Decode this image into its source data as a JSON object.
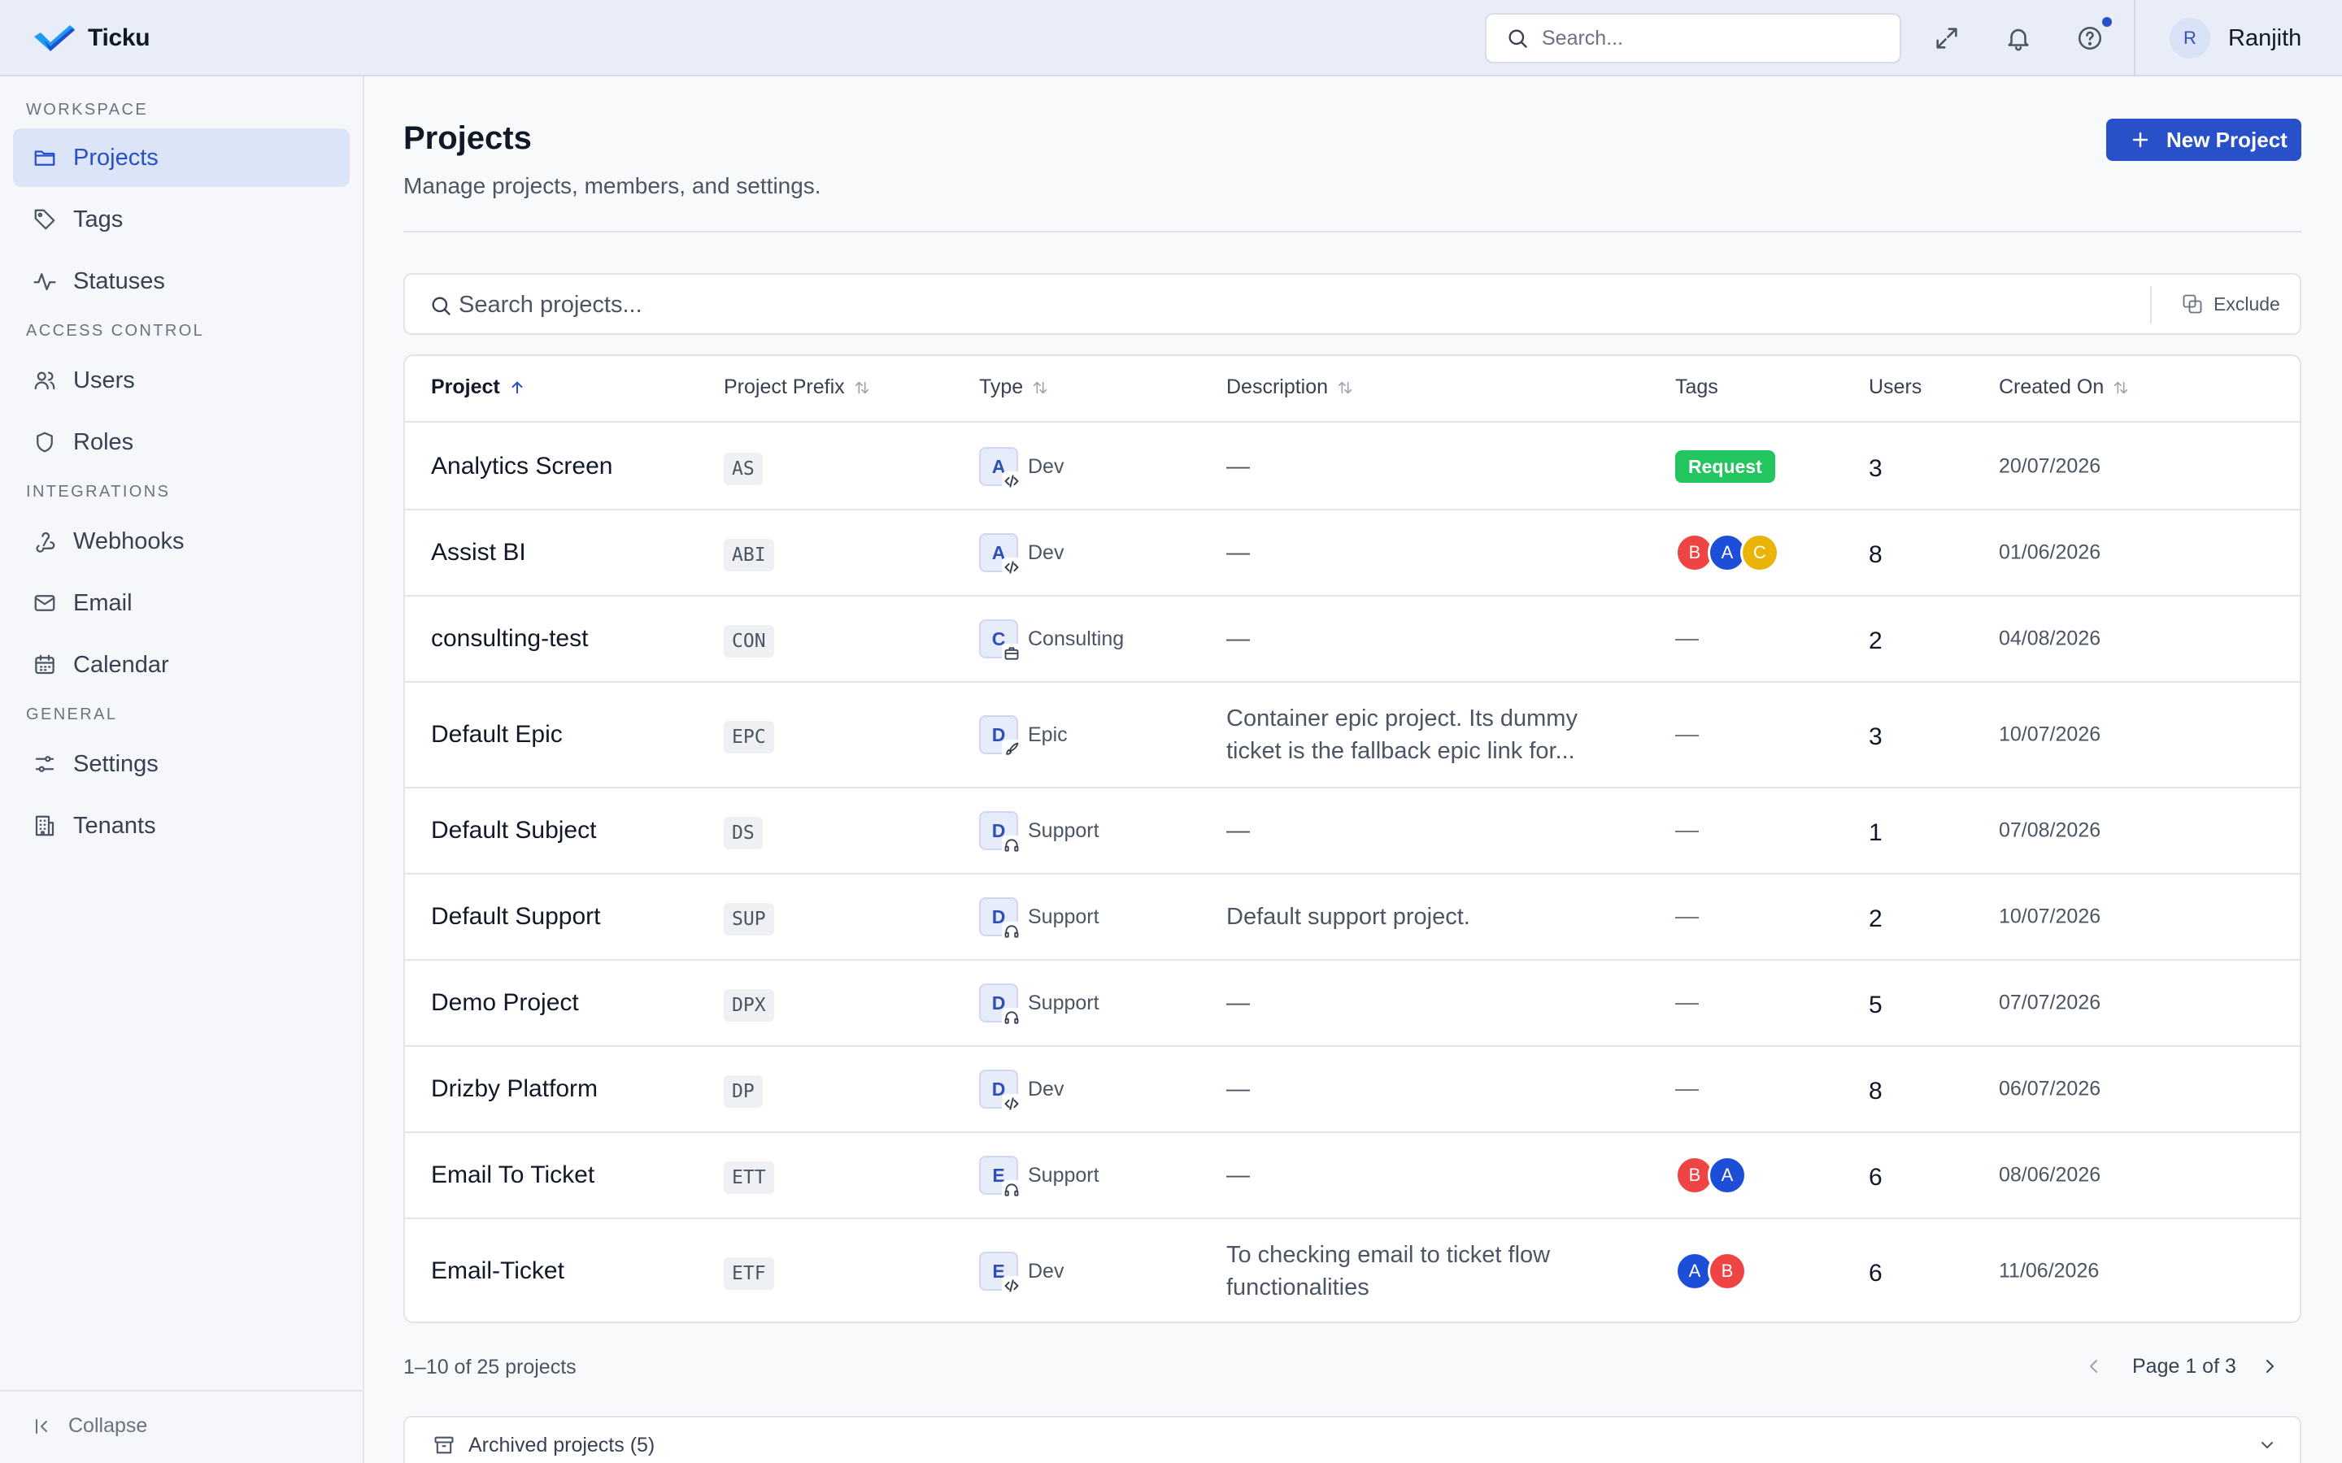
{
  "app": {
    "name": "Ticku"
  },
  "topbar": {
    "search_placeholder": "Search...",
    "user": {
      "initial": "R",
      "name": "Ranjith"
    },
    "notification_dot_color": "#2850c8"
  },
  "sidebar": {
    "sections": [
      {
        "label": "WORKSPACE",
        "items": [
          {
            "label": "Projects",
            "icon": "folder-icon",
            "active": true
          },
          {
            "label": "Tags",
            "icon": "tag-icon"
          },
          {
            "label": "Statuses",
            "icon": "activity-icon"
          }
        ]
      },
      {
        "label": "ACCESS CONTROL",
        "items": [
          {
            "label": "Users",
            "icon": "users-icon"
          },
          {
            "label": "Roles",
            "icon": "shield-icon"
          }
        ]
      },
      {
        "label": "INTEGRATIONS",
        "items": [
          {
            "label": "Webhooks",
            "icon": "webhook-icon"
          },
          {
            "label": "Email",
            "icon": "mail-icon"
          },
          {
            "label": "Calendar",
            "icon": "calendar-icon"
          }
        ]
      },
      {
        "label": "GENERAL",
        "items": [
          {
            "label": "Settings",
            "icon": "sliders-icon"
          },
          {
            "label": "Tenants",
            "icon": "building-icon"
          }
        ]
      }
    ],
    "collapse_label": "Collapse"
  },
  "page": {
    "title": "Projects",
    "subtitle": "Manage projects, members, and settings.",
    "new_button": "New Project",
    "search_placeholder": "Search projects...",
    "exclude_label": "Exclude"
  },
  "table": {
    "columns": [
      {
        "label": "Project",
        "sort": "asc"
      },
      {
        "label": "Project Prefix",
        "sort": "none"
      },
      {
        "label": "Type",
        "sort": "none"
      },
      {
        "label": "Description",
        "sort": "none"
      },
      {
        "label": "Tags"
      },
      {
        "label": "Users"
      },
      {
        "label": "Created On",
        "sort": "none"
      }
    ],
    "rows": [
      {
        "name": "Analytics Screen",
        "prefix": "AS",
        "type_initial": "A",
        "type": "Dev",
        "type_icon": "code-icon",
        "description": "—",
        "tags": {
          "kind": "pill",
          "label": "Request",
          "color": "#22c55e"
        },
        "users": "3",
        "created": "20/07/2026"
      },
      {
        "name": "Assist BI",
        "prefix": "ABI",
        "type_initial": "A",
        "type": "Dev",
        "type_icon": "code-icon",
        "description": "—",
        "tags": {
          "kind": "avatars",
          "list": [
            {
              "initial": "B",
              "color": "#ef4444"
            },
            {
              "initial": "A",
              "color": "#1d4ed8"
            },
            {
              "initial": "C",
              "color": "#eab308"
            }
          ]
        },
        "users": "8",
        "created": "01/06/2026"
      },
      {
        "name": "consulting-test",
        "prefix": "CON",
        "type_initial": "C",
        "type": "Consulting",
        "type_icon": "briefcase-icon",
        "description": "—",
        "tags": {
          "kind": "none",
          "label": "—"
        },
        "users": "2",
        "created": "04/08/2026"
      },
      {
        "name": "Default Epic",
        "prefix": "EPC",
        "type_initial": "D",
        "type": "Epic",
        "type_icon": "rocket-icon",
        "description": "Container epic project. Its dummy ticket is the fallback epic link for...",
        "tags": {
          "kind": "none",
          "label": "—"
        },
        "users": "3",
        "created": "10/07/2026"
      },
      {
        "name": "Default Subject",
        "prefix": "DS",
        "type_initial": "D",
        "type": "Support",
        "type_icon": "headset-icon",
        "description": "—",
        "tags": {
          "kind": "none",
          "label": "—"
        },
        "users": "1",
        "created": "07/08/2026"
      },
      {
        "name": "Default Support",
        "prefix": "SUP",
        "type_initial": "D",
        "type": "Support",
        "type_icon": "headset-icon",
        "description": "Default support project.",
        "tags": {
          "kind": "none",
          "label": "—"
        },
        "users": "2",
        "created": "10/07/2026"
      },
      {
        "name": "Demo Project",
        "prefix": "DPX",
        "type_initial": "D",
        "type": "Support",
        "type_icon": "headset-icon",
        "description": "—",
        "tags": {
          "kind": "none",
          "label": "—"
        },
        "users": "5",
        "created": "07/07/2026"
      },
      {
        "name": "Drizby Platform",
        "prefix": "DP",
        "type_initial": "D",
        "type": "Dev",
        "type_icon": "code-icon",
        "description": "—",
        "tags": {
          "kind": "none",
          "label": "—"
        },
        "users": "8",
        "created": "06/07/2026"
      },
      {
        "name": "Email To Ticket",
        "prefix": "ETT",
        "type_initial": "E",
        "type": "Support",
        "type_icon": "headset-icon",
        "description": "—",
        "tags": {
          "kind": "avatars",
          "list": [
            {
              "initial": "B",
              "color": "#ef4444"
            },
            {
              "initial": "A",
              "color": "#1d4ed8"
            }
          ]
        },
        "users": "6",
        "created": "08/06/2026"
      },
      {
        "name": "Email-Ticket",
        "prefix": "ETF",
        "type_initial": "E",
        "type": "Dev",
        "type_icon": "code-icon",
        "description": "To checking email to ticket flow functionalities",
        "tags": {
          "kind": "avatars",
          "list": [
            {
              "initial": "A",
              "color": "#1d4ed8"
            },
            {
              "initial": "B",
              "color": "#ef4444"
            }
          ]
        },
        "users": "6",
        "created": "11/06/2026"
      }
    ]
  },
  "footer": {
    "count": "1–10 of 25 projects",
    "page": "Page 1 of 3",
    "archived_label": "Archived projects (5)"
  },
  "colors": {
    "accent": "#2850c8",
    "active_nav_bg": "#dce5f7",
    "topbar_bg": "#e8edf7"
  }
}
